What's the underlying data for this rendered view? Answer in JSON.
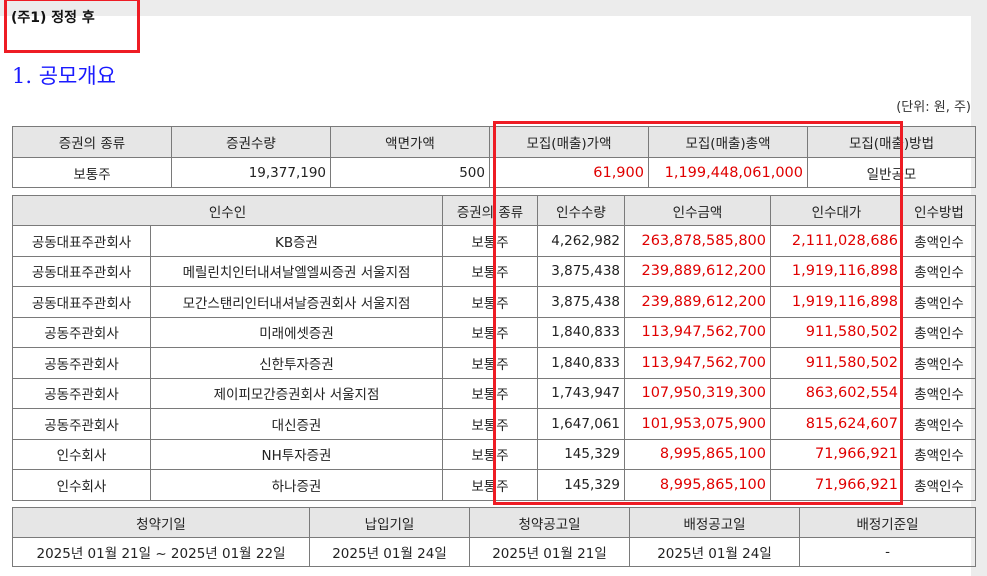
{
  "note": "(주1) 정정 후",
  "heading": "1. 공모개요",
  "unit": "(단위: 원, 주)",
  "table1": {
    "headers": [
      "증권의 종류",
      "증권수량",
      "액면가액",
      "모집(매출)가액",
      "모집(매출)총액",
      "모집(매출)방법"
    ],
    "row": [
      "보통주",
      "19,377,190",
      "500",
      "61,900",
      "1,199,448,061,000",
      "일반공모"
    ]
  },
  "table2": {
    "headers": [
      "인수인",
      "증권의 종류",
      "인수수량",
      "인수금액",
      "인수대가",
      "인수방법"
    ],
    "rows": [
      [
        "공동대표주관회사",
        "KB증권",
        "보통주",
        "4,262,982",
        "263,878,585,800",
        "2,111,028,686",
        "총액인수"
      ],
      [
        "공동대표주관회사",
        "메릴린치인터내셔날엘엘씨증권 서울지점",
        "보통주",
        "3,875,438",
        "239,889,612,200",
        "1,919,116,898",
        "총액인수"
      ],
      [
        "공동대표주관회사",
        "모간스탠리인터내셔날증권회사 서울지점",
        "보통주",
        "3,875,438",
        "239,889,612,200",
        "1,919,116,898",
        "총액인수"
      ],
      [
        "공동주관회사",
        "미래에셋증권",
        "보통주",
        "1,840,833",
        "113,947,562,700",
        "911,580,502",
        "총액인수"
      ],
      [
        "공동주관회사",
        "신한투자증권",
        "보통주",
        "1,840,833",
        "113,947,562,700",
        "911,580,502",
        "총액인수"
      ],
      [
        "공동주관회사",
        "제이피모간증권회사 서울지점",
        "보통주",
        "1,743,947",
        "107,950,319,300",
        "863,602,554",
        "총액인수"
      ],
      [
        "공동주관회사",
        "대신증권",
        "보통주",
        "1,647,061",
        "101,953,075,900",
        "815,624,607",
        "총액인수"
      ],
      [
        "인수회사",
        "NH투자증권",
        "보통주",
        "145,329",
        "8,995,865,100",
        "71,966,921",
        "총액인수"
      ],
      [
        "인수회사",
        "하나증권",
        "보통주",
        "145,329",
        "8,995,865,100",
        "71,966,921",
        "총액인수"
      ]
    ]
  },
  "table3": {
    "headers": [
      "청약기일",
      "납입기일",
      "청약공고일",
      "배정공고일",
      "배정기준일"
    ],
    "row": [
      "2025년 01월 21일 ~ 2025년 01월 22일",
      "2025년 01월 24일",
      "2025년 01월 21일",
      "2025년 01월 24일",
      "-"
    ]
  },
  "colors": {
    "highlight": "#ee1c24",
    "value_red": "#e00000",
    "heading_blue": "#1a1aff",
    "header_bg": "#e6e6e6"
  }
}
